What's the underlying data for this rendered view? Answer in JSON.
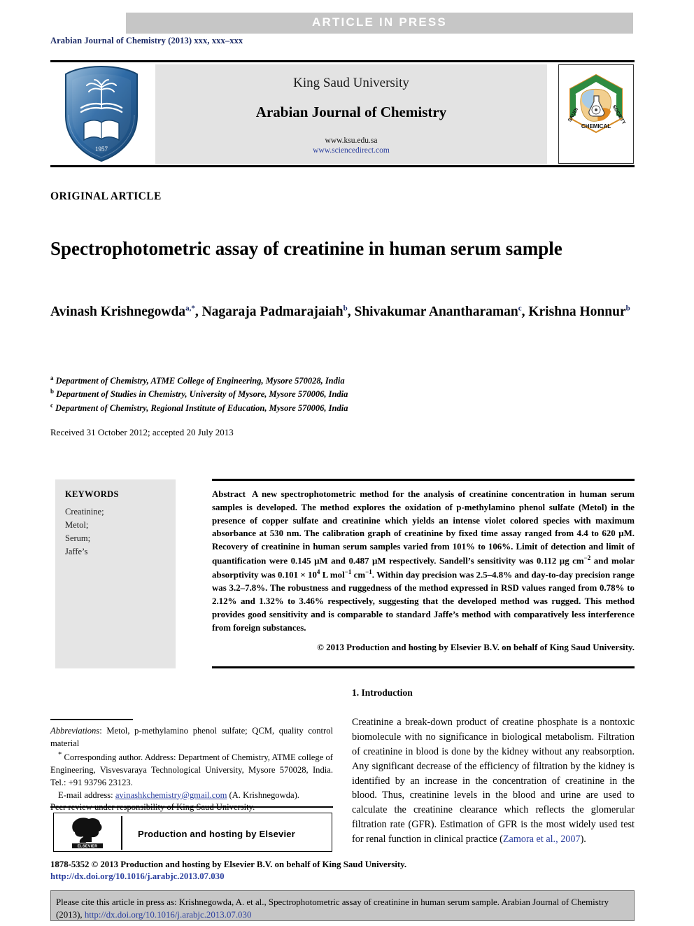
{
  "banner": {
    "label": "ARTICLE  IN  PRESS",
    "background": "#c6c6c6",
    "text_color": "#ffffff"
  },
  "running_head": {
    "text": "Arabian Journal of Chemistry (2013) xxx, xxx–xxx",
    "color": "#1b2a66"
  },
  "masthead": {
    "university": "King Saud University",
    "journal": "Arabian Journal of Chemistry",
    "url_ksu": "www.ksu.edu.sa",
    "url_sciencedirect": "www.sciencedirect.com",
    "panel_background": "#e3e3e3",
    "left_logo_name": "king-saud-university-shield-logo",
    "left_logo_caption": "King Saud University 1957",
    "right_logo_name": "saudi-chemical-society-hexagon-logo",
    "right_logo_caption_top": "SAUDI",
    "right_logo_caption_right": "SOCIETY",
    "right_logo_caption_bottom": "CHEMICAL"
  },
  "article": {
    "type": "ORIGINAL ARTICLE",
    "title": "Spectrophotometric assay of creatinine in human serum sample",
    "received": "Received 31 October 2012; accepted 20 July 2013"
  },
  "authors": [
    {
      "name": "Avinash Krishnegowda",
      "marks": "a,*"
    },
    {
      "name": "Nagaraja Padmarajaiah",
      "marks": "b"
    },
    {
      "name": "Shivakumar Anantharaman",
      "marks": "c"
    },
    {
      "name": "Krishna Honnur",
      "marks": "b"
    }
  ],
  "affiliations": [
    {
      "mark": "a",
      "text": "Department of Chemistry, ATME College of Engineering, Mysore 570028, India"
    },
    {
      "mark": "b",
      "text": "Department of Studies in Chemistry, University of Mysore, Mysore 570006, India"
    },
    {
      "mark": "c",
      "text": "Department of Chemistry, Regional Institute of Education, Mysore 570006, India"
    }
  ],
  "keywords": {
    "heading": "KEYWORDS",
    "items": [
      "Creatinine;",
      "Metol;",
      "Serum;",
      "Jaffe’s"
    ],
    "background": "#e5e5e5"
  },
  "abstract": {
    "label": "Abstract",
    "body_part1": "A new spectrophotometric method for the analysis of creatinine concentration in human serum samples is developed. The method explores the oxidation of p-methylamino phenol sulfate (Metol) in the presence of copper sulfate and creatinine which yields an intense violet colored species with maximum absorbance at 530 nm. The calibration graph of creatinine by fixed time assay ranged from 4.4 to 620 µM. Recovery of creatinine in human serum samples varied from 101% to 106%. Limit of detection and limit of quantification were 0.145 µM and 0.487 µM respectively. Sandell’s sensitivity was 0.112 µg cm",
    "sup1": "−2",
    "body_part2": " and molar absorptivity was 0.101 × 10",
    "sup2": "4",
    "body_part3": " L mol",
    "sup3": "−1",
    "body_part4": " cm",
    "sup4": "−1",
    "body_part5": ". Within day precision was 2.5–4.8% and day-to-day precision range was 3.2–7.8%. The robustness and ruggedness of the method expressed in RSD values ranged from 0.78% to 2.12% and 1.32% to 3.46% respectively, suggesting that the developed method was rugged. This method provides good sensitivity and is comparable to standard Jaffe’s method with comparatively less interference from foreign substances.",
    "copyright": "© 2013 Production and hosting by Elsevier B.V. on behalf of King Saud University."
  },
  "introduction": {
    "heading": "1. Introduction",
    "paragraph_pre": "Creatinine a break-down product of creatine phosphate is a nontoxic biomolecule with no significance in biological metabolism. Filtration of creatinine in blood is done by the kidney without any reabsorption. Any significant decrease of the efficiency of filtration by the kidney is identified by an increase in the concentration of creatinine in the blood. Thus, creatinine levels in the blood and urine are used to calculate the creatinine clearance which reflects the glomerular filtration rate (GFR). Estimation of GFR is the most widely used test for renal function in clinical practice (",
    "citation": "Zamora et al., 2007",
    "paragraph_post": ")."
  },
  "footnotes": {
    "abbrev_label": "Abbreviations",
    "abbrev_text": ": Metol, p-methylamino phenol sulfate; QCM, quality control material",
    "corresponding_mark": "*",
    "corresponding_text": "Corresponding author. Address: Department of Chemistry, ATME college of Engineering, Visvesvaraya Technological University, Mysore 570028, India. Tel.: +91 93796 23123.",
    "email_label": "E-mail address:",
    "email": "avinashkchemistry@gmail.com",
    "email_author": "(A. Krishnegowda).",
    "peer_review": "Peer review under responsibility of King Saud University."
  },
  "elsevier_box": {
    "label": "Production and hosting by Elsevier",
    "logo_name": "elsevier-tree-logo",
    "logo_wordmark": "ELSEVIER"
  },
  "issn_line": "1878-5352 © 2013 Production and hosting by Elsevier B.V. on behalf of King Saud University.",
  "doi_line": "http://dx.doi.org/10.1016/j.arabjc.2013.07.030",
  "citation_footer": {
    "text_pre": "Please cite this article in press as: Krishnegowda, A. et al., Spectrophotometric assay of creatinine in human serum sample. Arabian Journal of Chemistry (2013), ",
    "link": "http://dx.doi.org/10.1016/j.arabjc.2013.07.030",
    "background": "#c6c6c6"
  }
}
